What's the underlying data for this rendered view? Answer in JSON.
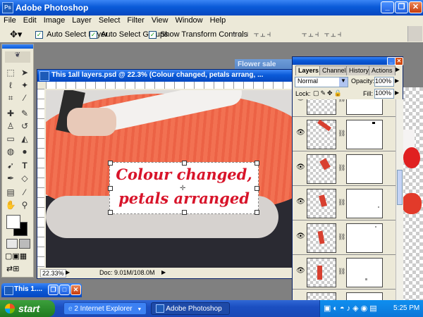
{
  "app": {
    "title": "Adobe Photoshop"
  },
  "menu": [
    "File",
    "Edit",
    "Image",
    "Layer",
    "Select",
    "Filter",
    "View",
    "Window",
    "Help"
  ],
  "options": {
    "auto_select_layer": "Auto Select Layer",
    "auto_select_groups": "Auto Select Groups",
    "show_transform": "Show Transform Controls"
  },
  "document": {
    "title": "This 1all layers.psd @ 22.3% (Colour changed,  petals arrang, ...",
    "zoom": "22.33%",
    "doc_info": "Doc: 9.01M/108.0M",
    "text_line1": "Colour changed,",
    "text_line2": "petals arranged"
  },
  "back_window": {
    "title": "Flower sale"
  },
  "layers_panel": {
    "tabs": [
      "Layers",
      "Channels",
      "History",
      "Actions"
    ],
    "blend_mode": "Normal",
    "opacity_label": "Opacity:",
    "opacity_value": "100%",
    "lock_label": "Lock:",
    "fill_label": "Fill:",
    "fill_value": "100%"
  },
  "minimized_window": {
    "title": "This 1...."
  },
  "taskbar": {
    "start": "start",
    "items": [
      "2 Internet Explorer",
      "Adobe Photoshop"
    ],
    "clock": "5:25 PM"
  },
  "colors": {
    "accent_text": "#d8142a",
    "tutu": "#f07050"
  }
}
